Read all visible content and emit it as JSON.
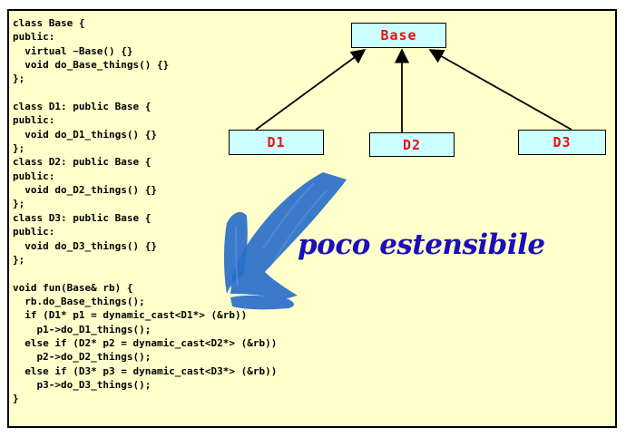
{
  "code_lines": [
    "class Base {",
    "public:",
    "  virtual ~Base() {}",
    "  void do_Base_things() {}",
    "};",
    "",
    "class D1: public Base {",
    "public:",
    "  void do_D1_things() {}",
    "};",
    "class D2: public Base {",
    "public:",
    "  void do_D2_things() {}",
    "};",
    "class D3: public Base {",
    "public:",
    "  void do_D3_things() {}",
    "};",
    "",
    "void fun(Base& rb) {",
    "  rb.do_Base_things();",
    "  if (D1* p1 = dynamic_cast<D1*> (&rb))",
    "    p1->do_D1_things();",
    "  else if (D2* p2 = dynamic_cast<D2*> (&rb))",
    "    p2->do_D2_things();",
    "  else if (D3* p3 = dynamic_cast<D3*> (&rb))",
    "    p3->do_D3_things();",
    "}"
  ],
  "diagram": {
    "base": "Base",
    "d1": "D1",
    "d2": "D2",
    "d3": "D3"
  },
  "annotation": "poco estensibile",
  "colors": {
    "slide_background": "#ffffcc",
    "box_fill": "#ccffff",
    "box_text": "#ee1111",
    "annotation_text": "#1a0fb8",
    "brush_stroke": "#2a6fc9"
  }
}
